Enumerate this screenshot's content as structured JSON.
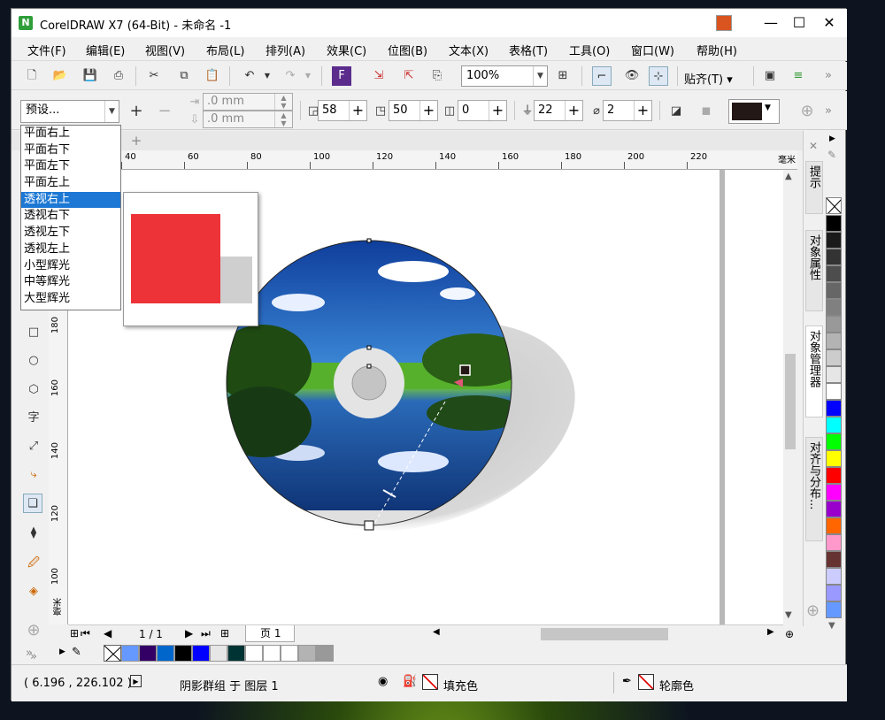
{
  "app": {
    "title": "CorelDRAW X7 (64-Bit) - 未命名 -1"
  },
  "menu": [
    "文件(F)",
    "编辑(E)",
    "视图(V)",
    "布局(L)",
    "排列(A)",
    "效果(C)",
    "位图(B)",
    "文本(X)",
    "表格(T)",
    "工具(O)",
    "窗口(W)",
    "帮助(H)"
  ],
  "toolbar1": {
    "zoom": "100%",
    "snap": "贴齐(T)"
  },
  "toolbar2": {
    "preset": "预设...",
    "x_value": ".0 mm",
    "y_value": ".0 mm",
    "opacity": "58",
    "feather": "50",
    "fade": "0",
    "stretch": "22",
    "angle": "2"
  },
  "preset_list": {
    "options": [
      "平面右上",
      "平面右下",
      "平面左下",
      "平面左上",
      "透视右上",
      "透视右下",
      "透视左下",
      "透视左上",
      "小型辉光",
      "中等辉光",
      "大型辉光"
    ],
    "selected": "透视右上"
  },
  "ruler": {
    "h_ticks": [
      "40",
      "60",
      "80",
      "100",
      "120",
      "140",
      "160",
      "180",
      "200",
      "220"
    ],
    "h_unit": "毫米",
    "v_ticks": [
      "180",
      "160",
      "140",
      "120",
      "100"
    ],
    "v_unit": "毫米"
  },
  "dock_tabs": [
    "提示",
    "对象属性",
    "对象管理器",
    "对齐与分布..."
  ],
  "palette": [
    "#000000",
    "#1a1a1a",
    "#333333",
    "#4d4d4d",
    "#666666",
    "#808080",
    "#999999",
    "#b3b3b3",
    "#cccccc",
    "#e6e6e6",
    "#ffffff",
    "#0000ff",
    "#00ffff",
    "#00ff00",
    "#ffff00",
    "#ff0000",
    "#ff00ff",
    "#9900cc",
    "#ff6600",
    "#ff99cc",
    "#663333",
    "#ccccff",
    "#9999ff",
    "#6699ff"
  ],
  "doc_palette": [
    "#6699ff",
    "#330066",
    "#0066cc",
    "#000000",
    "#0000ff",
    "#e6e6e6",
    "#003333",
    "#ffffff",
    "#ffffff",
    "#ffffff",
    "#b3b3b3",
    "#999999"
  ],
  "pagebar": {
    "page_count": "1 / 1",
    "page_tab": "页 1"
  },
  "status": {
    "coords": "( 6.196 , 226.102 )",
    "object": "阴影群组 于 图层 1",
    "fill": "填充色",
    "outline": "轮廓色"
  },
  "toolbox": {
    "text_tool": "字"
  },
  "colors": {
    "accent": "#1c78d4",
    "preview_square": "#ee3338"
  }
}
